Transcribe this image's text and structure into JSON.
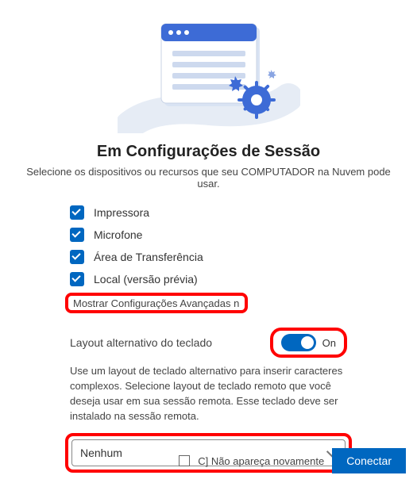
{
  "title": "Em Configurações de Sessão",
  "subtitle": "Selecione os dispositivos ou recursos que seu COMPUTADOR na Nuvem pode usar.",
  "options": {
    "printer": {
      "label": "Impressora",
      "checked": true
    },
    "mic": {
      "label": "Microfone",
      "checked": true
    },
    "clipboard": {
      "label": "Área de Transferência",
      "checked": true
    },
    "location": {
      "label": "Local (versão prévia)",
      "checked": true
    }
  },
  "advanced_toggle_text": "Mostrar Configurações Avançadas n",
  "alt_kb": {
    "label": "Layout alternativo do teclado",
    "state_text": "On",
    "on": true,
    "description": "Use um layout de teclado alternativo para inserir caracteres complexos. Selecione layout de teclado remoto que você deseja usar em sua sessão remota. Esse teclado deve ser instalado na sessão remota.",
    "selected": "Nenhum"
  },
  "dont_show_again": {
    "label": "C] Não apareça novamente",
    "checked": false
  },
  "connect_button": "Conectar",
  "colors": {
    "accent": "#0067c0",
    "highlight": "#ff0000"
  }
}
